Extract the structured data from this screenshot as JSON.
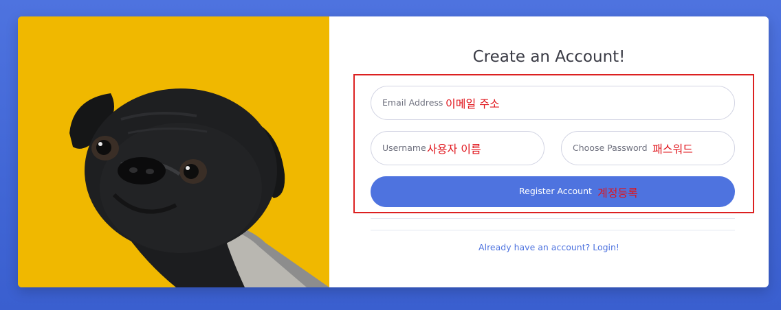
{
  "form": {
    "title": "Create an Account!",
    "email": {
      "placeholder": "Email Address",
      "annotation": "이메일 주소"
    },
    "username": {
      "placeholder": "Username",
      "annotation": "사용자 이름"
    },
    "password": {
      "placeholder": "Choose Password",
      "annotation": "패스워드"
    },
    "register_button": {
      "label": "Register Account",
      "annotation": "계정등록"
    },
    "login_link": "Already have an account? Login!"
  },
  "colors": {
    "brand": "#4e73df",
    "photo_background": "#f0b800",
    "annotation": "#dc2020"
  },
  "icons": {
    "photo": "pug-dog-image"
  }
}
